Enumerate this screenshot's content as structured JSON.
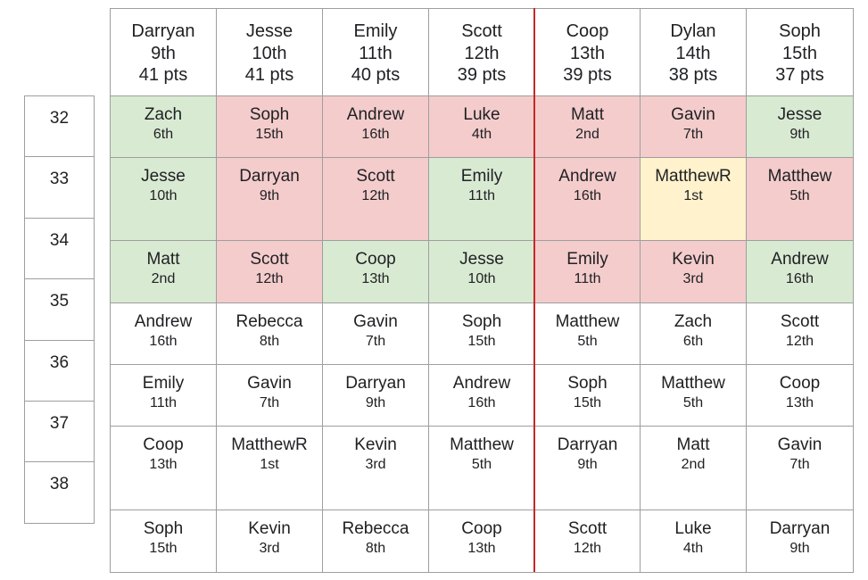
{
  "headers": [
    {
      "name": "Darryan",
      "place": "9th",
      "pts": "41 pts"
    },
    {
      "name": "Jesse",
      "place": "10th",
      "pts": "41 pts"
    },
    {
      "name": "Emily",
      "place": "11th",
      "pts": "40 pts"
    },
    {
      "name": "Scott",
      "place": "12th",
      "pts": "39 pts"
    },
    {
      "name": "Coop",
      "place": "13th",
      "pts": "39 pts"
    },
    {
      "name": "Dylan",
      "place": "14th",
      "pts": "38 pts"
    },
    {
      "name": "Soph",
      "place": "15th",
      "pts": "37 pts"
    }
  ],
  "row_labels": [
    "32",
    "33",
    "34",
    "35",
    "36",
    "37",
    "38"
  ],
  "rows": [
    [
      {
        "name": "Zach",
        "rank": "6th",
        "status": "green"
      },
      {
        "name": "Soph",
        "rank": "15th",
        "status": "red"
      },
      {
        "name": "Andrew",
        "rank": "16th",
        "status": "red"
      },
      {
        "name": "Luke",
        "rank": "4th",
        "status": "red"
      },
      {
        "name": "Matt",
        "rank": "2nd",
        "status": "red"
      },
      {
        "name": "Gavin",
        "rank": "7th",
        "status": "red"
      },
      {
        "name": "Jesse",
        "rank": "9th",
        "status": "green"
      }
    ],
    [
      {
        "name": "Jesse",
        "rank": "10th",
        "status": "green"
      },
      {
        "name": "Darryan",
        "rank": "9th",
        "status": "red"
      },
      {
        "name": "Scott",
        "rank": "12th",
        "status": "red"
      },
      {
        "name": "Emily",
        "rank": "11th",
        "status": "green"
      },
      {
        "name": "Andrew",
        "rank": "16th",
        "status": "red"
      },
      {
        "name": "MatthewR",
        "rank": "1st",
        "status": "yellow"
      },
      {
        "name": "Matthew",
        "rank": "5th",
        "status": "red"
      }
    ],
    [
      {
        "name": "Matt",
        "rank": "2nd",
        "status": "green"
      },
      {
        "name": "Scott",
        "rank": "12th",
        "status": "red"
      },
      {
        "name": "Coop",
        "rank": "13th",
        "status": "green"
      },
      {
        "name": "Jesse",
        "rank": "10th",
        "status": "green"
      },
      {
        "name": "Emily",
        "rank": "11th",
        "status": "red"
      },
      {
        "name": "Kevin",
        "rank": "3rd",
        "status": "red"
      },
      {
        "name": "Andrew",
        "rank": "16th",
        "status": "green"
      }
    ],
    [
      {
        "name": "Andrew",
        "rank": "16th",
        "status": "white"
      },
      {
        "name": "Rebecca",
        "rank": "8th",
        "status": "white"
      },
      {
        "name": "Gavin",
        "rank": "7th",
        "status": "white"
      },
      {
        "name": "Soph",
        "rank": "15th",
        "status": "white"
      },
      {
        "name": "Matthew",
        "rank": "5th",
        "status": "white"
      },
      {
        "name": "Zach",
        "rank": "6th",
        "status": "white"
      },
      {
        "name": "Scott",
        "rank": "12th",
        "status": "white"
      }
    ],
    [
      {
        "name": "Emily",
        "rank": "11th",
        "status": "white"
      },
      {
        "name": "Gavin",
        "rank": "7th",
        "status": "white"
      },
      {
        "name": "Darryan",
        "rank": "9th",
        "status": "white"
      },
      {
        "name": "Andrew",
        "rank": "16th",
        "status": "white"
      },
      {
        "name": "Soph",
        "rank": "15th",
        "status": "white"
      },
      {
        "name": "Matthew",
        "rank": "5th",
        "status": "white"
      },
      {
        "name": "Coop",
        "rank": "13th",
        "status": "white"
      }
    ],
    [
      {
        "name": "Coop",
        "rank": "13th",
        "status": "white"
      },
      {
        "name": "MatthewR",
        "rank": "1st",
        "status": "white"
      },
      {
        "name": "Kevin",
        "rank": "3rd",
        "status": "white"
      },
      {
        "name": "Matthew",
        "rank": "5th",
        "status": "white"
      },
      {
        "name": "Darryan",
        "rank": "9th",
        "status": "white"
      },
      {
        "name": "Matt",
        "rank": "2nd",
        "status": "white"
      },
      {
        "name": "Gavin",
        "rank": "7th",
        "status": "white"
      }
    ],
    [
      {
        "name": "Soph",
        "rank": "15th",
        "status": "white"
      },
      {
        "name": "Kevin",
        "rank": "3rd",
        "status": "white"
      },
      {
        "name": "Rebecca",
        "rank": "8th",
        "status": "white"
      },
      {
        "name": "Coop",
        "rank": "13th",
        "status": "white"
      },
      {
        "name": "Scott",
        "rank": "12th",
        "status": "white"
      },
      {
        "name": "Luke",
        "rank": "4th",
        "status": "white"
      },
      {
        "name": "Darryan",
        "rank": "9th",
        "status": "white"
      }
    ]
  ],
  "colors": {
    "green": "#d9ead3",
    "red": "#f4cccc",
    "yellow": "#fff2cc",
    "white": "#ffffff",
    "divider": "#c62828",
    "border": "#9e9e9e"
  }
}
